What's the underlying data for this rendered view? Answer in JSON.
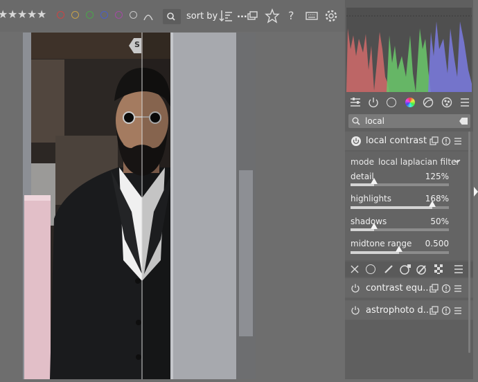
{
  "toolbar": {
    "sort_label": "sort by",
    "color_labels": [
      "#cc4444",
      "#c8a24a",
      "#4aa64a",
      "#4a5ec8",
      "#a44aa4"
    ],
    "ellipsis": "..."
  },
  "image": {
    "before_after_badge": "S"
  },
  "panel": {
    "search": {
      "value": "local"
    },
    "module_local_contrast": {
      "title": "local contrast",
      "mode_label": "mode",
      "mode_value": "local laplacian filter",
      "sliders": [
        {
          "label": "detail",
          "value_text": "125%",
          "level": 0.24
        },
        {
          "label": "highlights",
          "value_text": "168%",
          "level": 0.83
        },
        {
          "label": "shadows",
          "value_text": "50%",
          "level": 0.24
        },
        {
          "label": "midtone range",
          "value_text": "0.500",
          "level": 0.49
        }
      ]
    },
    "other_modules": [
      {
        "title": "contrast equ..."
      },
      {
        "title": "astrophoto d..."
      }
    ]
  }
}
